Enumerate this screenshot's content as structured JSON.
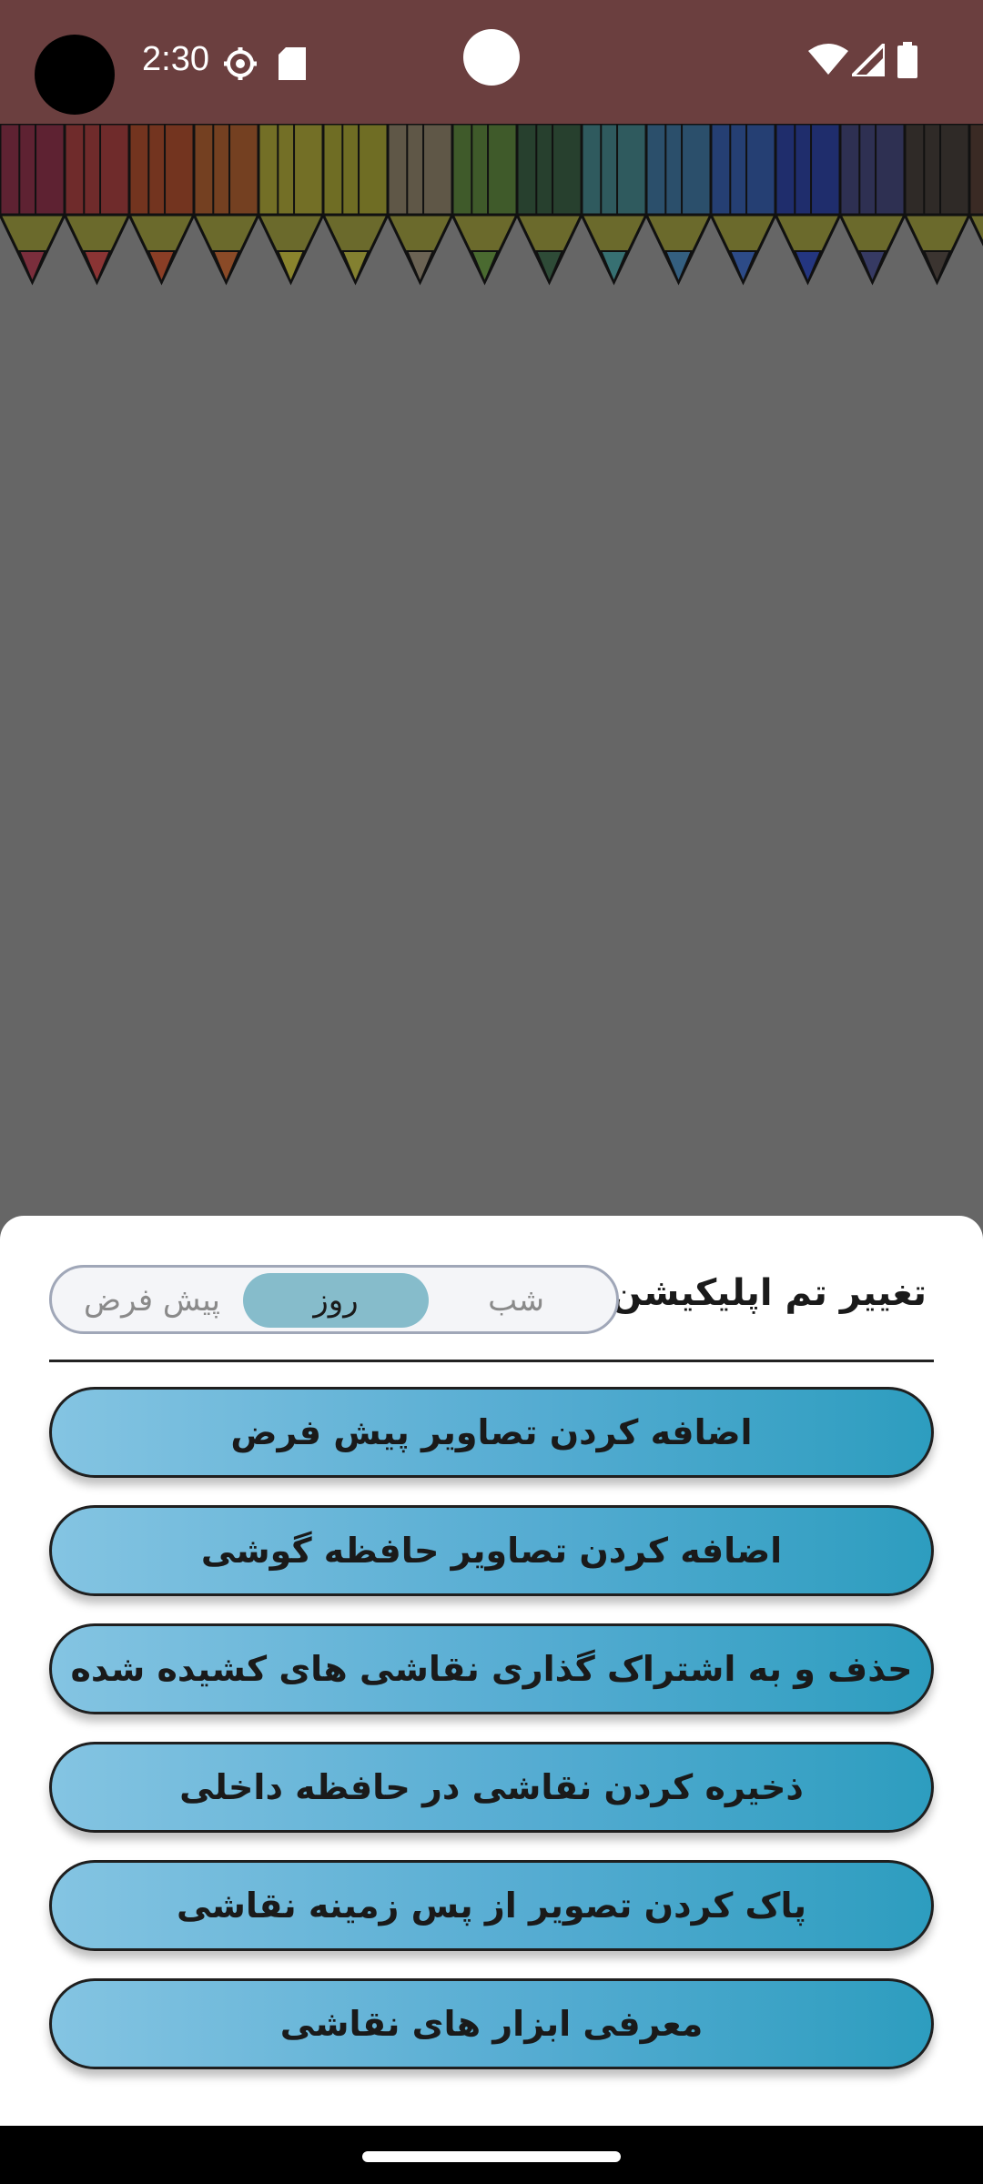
{
  "status_bar": {
    "time": "2:30",
    "icons": [
      "settings-icon",
      "sd-card-icon",
      "wifi-icon",
      "signal-icon",
      "battery-icon"
    ]
  },
  "pencils": {
    "colors": [
      "#5e2232",
      "#6f2b2b",
      "#73341f",
      "#744021",
      "#736f26",
      "#6f6d24",
      "#5f5747",
      "#3f5a2a",
      "#27402e",
      "#2f5a5e",
      "#2b4f6b",
      "#253f73",
      "#1f2d6c",
      "#2e3052",
      "#2f2a27",
      "#3a2a24"
    ],
    "tip_colors": [
      "#7a2e3c",
      "#8a3434",
      "#8a3e26",
      "#8a4a27",
      "#8a842d",
      "#838030",
      "#6b6354",
      "#4a6a30",
      "#2e4b37",
      "#377072",
      "#345f80",
      "#2d4b87",
      "#243680",
      "#363a63",
      "#3b3430",
      "#443430"
    ]
  },
  "sheet": {
    "theme_label": "تغییر تم اپلیکیشن:",
    "theme_options": {
      "night": "شب",
      "day": "روز",
      "default": "پیش فرض",
      "selected": "روز"
    },
    "menu_items": [
      "اضافه کردن تصاویر پیش فرض",
      "اضافه کردن تصاویر حافظه گوشی",
      "حذف و به اشتراک گذاری نقاشی های کشیده شده",
      "ذخیره کردن نقاشی در حافظه داخلی",
      "پاک کردن تصویر از پس زمینه نقاشی",
      "معرفی ابزار های نقاشی"
    ]
  }
}
